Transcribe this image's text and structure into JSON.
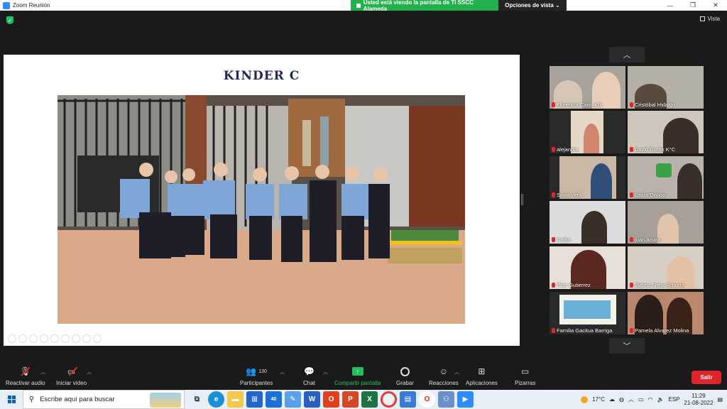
{
  "window": {
    "title": "Zoom Reunión",
    "minimize": "—",
    "maximize": "❐",
    "close": "✕"
  },
  "share_banner": {
    "text": "Usted está viendo la pantalla de TI SSCC Alameda",
    "view_options": "Opciones de vista ⌄"
  },
  "view_button": "Vista",
  "slide": {
    "title": "KINDER  C"
  },
  "gallery": {
    "tiles": [
      {
        "name": "Florencia Caro_KB"
      },
      {
        "name": "Cristóbal Hidalgo"
      },
      {
        "name": "alejandra"
      },
      {
        "name": "David Durán K°C"
      },
      {
        "name": "Silvia Vera"
      },
      {
        "name": "Laura Donoo"
      },
      {
        "name": "Catita"
      },
      {
        "name": "juan.acuna"
      },
      {
        "name": "Pilar Gutierrez"
      },
      {
        "name": "Violeta Nieto Achurra"
      },
      {
        "name": "Familia Gacitua Barriga"
      },
      {
        "name": "Pamela Alvarez Molina"
      }
    ]
  },
  "toolbar": {
    "unmute": "Reactivar audio",
    "start_video": "Iniciar vídeo",
    "participants": "Participantes",
    "participants_count": "130",
    "chat": "Chat",
    "share_screen": "Compartir pantalla",
    "record": "Grabar",
    "reactions": "Reacciones",
    "apps": "Aplicaciones",
    "whiteboards": "Pizarras",
    "leave": "Salir"
  },
  "taskbar": {
    "search_placeholder": "Escribe aquí para buscar",
    "mail_badge": "40",
    "temperature": "17°C",
    "language": "ESP",
    "time": "11:29",
    "date": "21-08-2022"
  },
  "colors": {
    "accent_green": "#22b14c",
    "leave_red": "#e0242b",
    "slide_title": "#1f2a55"
  }
}
